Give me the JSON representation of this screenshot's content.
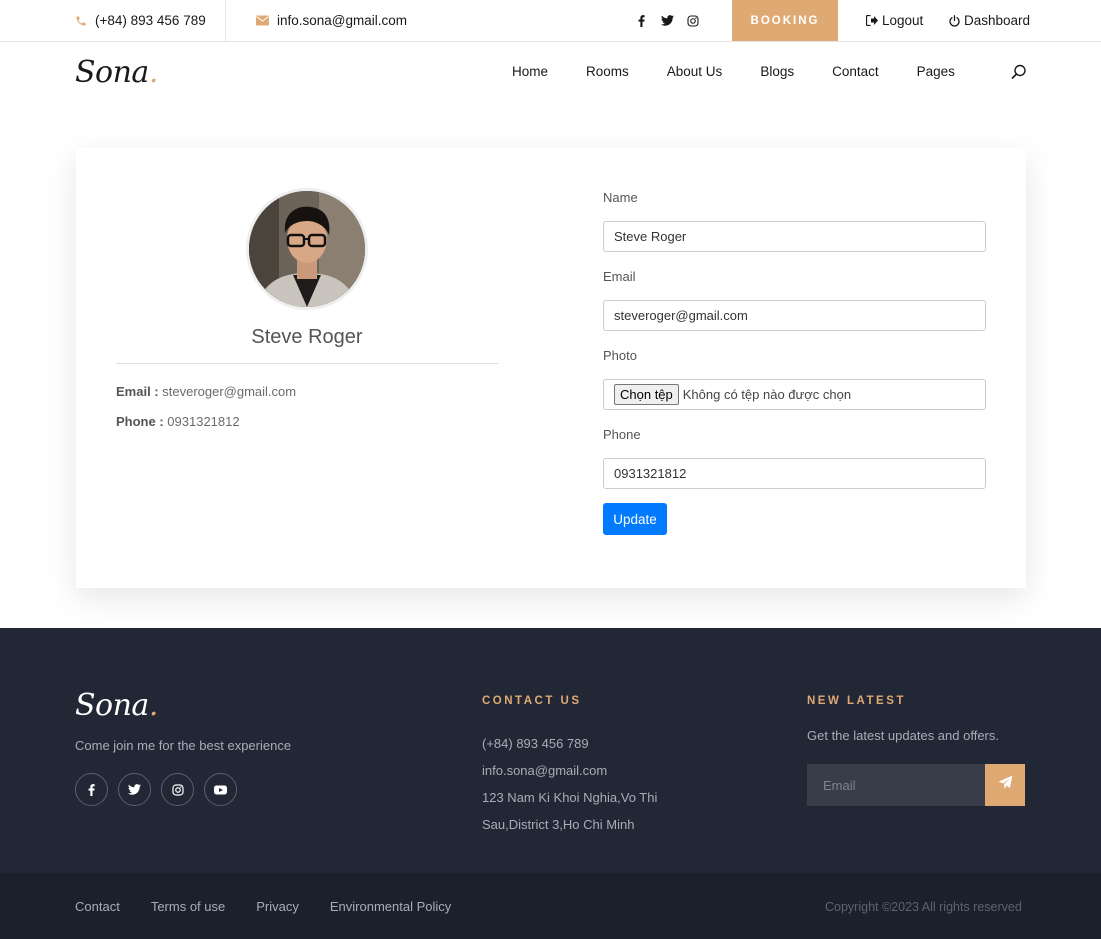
{
  "topbar": {
    "phone": "(+84) 893 456 789",
    "email": "info.sona@gmail.com",
    "booking": "BOOKING",
    "logout": "Logout",
    "dashboard": "Dashboard"
  },
  "nav": {
    "logo": "Sona",
    "logo_dot": ".",
    "items": [
      "Home",
      "Rooms",
      "About Us",
      "Blogs",
      "Contact",
      "Pages"
    ]
  },
  "profile": {
    "name": "Steve Roger",
    "email_label": "Email :",
    "email": "steveroger@gmail.com",
    "phone_label": "Phone :",
    "phone": "0931321812"
  },
  "form": {
    "name_label": "Name",
    "name_value": "Steve Roger",
    "email_label": "Email",
    "email_value": "steveroger@gmail.com",
    "photo_label": "Photo",
    "file_button": "Chọn tệp",
    "file_status": "Không có tệp nào được chọn",
    "phone_label": "Phone",
    "phone_value": "0931321812",
    "submit": "Update"
  },
  "footer": {
    "logo": "Sona",
    "logo_dot": ".",
    "tagline": "Come join me for the best experience",
    "contact_heading": "CONTACT US",
    "contact_phone": "(+84) 893 456 789",
    "contact_email": "info.sona@gmail.com",
    "contact_address": "123 Nam Ki Khoi Nghia,Vo Thi Sau,District 3,Ho Chi Minh",
    "news_heading": "NEW LATEST",
    "news_text": "Get the latest updates and offers.",
    "email_placeholder": "Email",
    "links": [
      "Contact",
      "Terms of use",
      "Privacy",
      "Environmental Policy"
    ],
    "copyright": "Copyright ©2023 All rights reserved"
  },
  "colors": {
    "accent": "#dfa974",
    "footer_bg": "#222736",
    "button_primary": "#007bff"
  }
}
